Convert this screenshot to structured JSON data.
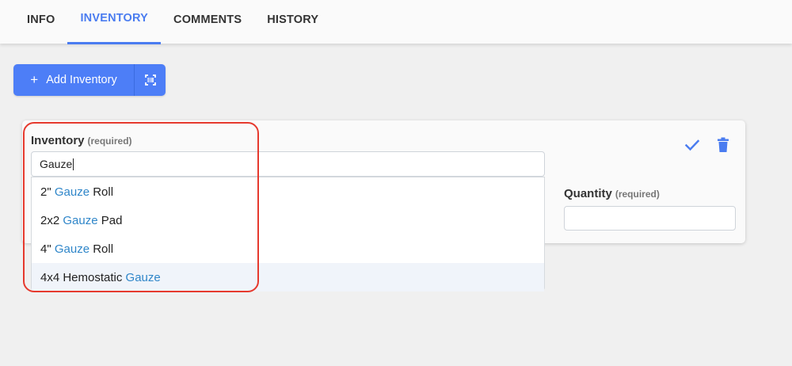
{
  "tabs": [
    {
      "label": "INFO",
      "active": false
    },
    {
      "label": "INVENTORY",
      "active": true
    },
    {
      "label": "COMMENTS",
      "active": false
    },
    {
      "label": "HISTORY",
      "active": false
    }
  ],
  "toolbar": {
    "add_label": "Add Inventory",
    "add_icon": "plus-icon",
    "scan_icon": "barcode-scan-icon"
  },
  "form": {
    "inventory_label": "Inventory",
    "inventory_required": "(required)",
    "inventory_value": "Gauze",
    "quantity_label": "Quantity",
    "quantity_required": "(required)",
    "quantity_value": ""
  },
  "dropdown": {
    "options": [
      {
        "pre": "2\" ",
        "match": "Gauze",
        "post": " Roll",
        "highlighted": false
      },
      {
        "pre": "2x2 ",
        "match": "Gauze",
        "post": " Pad",
        "highlighted": false
      },
      {
        "pre": "4\" ",
        "match": "Gauze",
        "post": " Roll",
        "highlighted": false
      },
      {
        "pre": "4x4 Hemostatic ",
        "match": "Gauze",
        "post": "",
        "highlighted": true
      }
    ]
  },
  "colors": {
    "accent": "#4a7cf0",
    "button": "#4d7ef7",
    "match_text": "#2f86c9",
    "annotation": "#e63a2e"
  }
}
